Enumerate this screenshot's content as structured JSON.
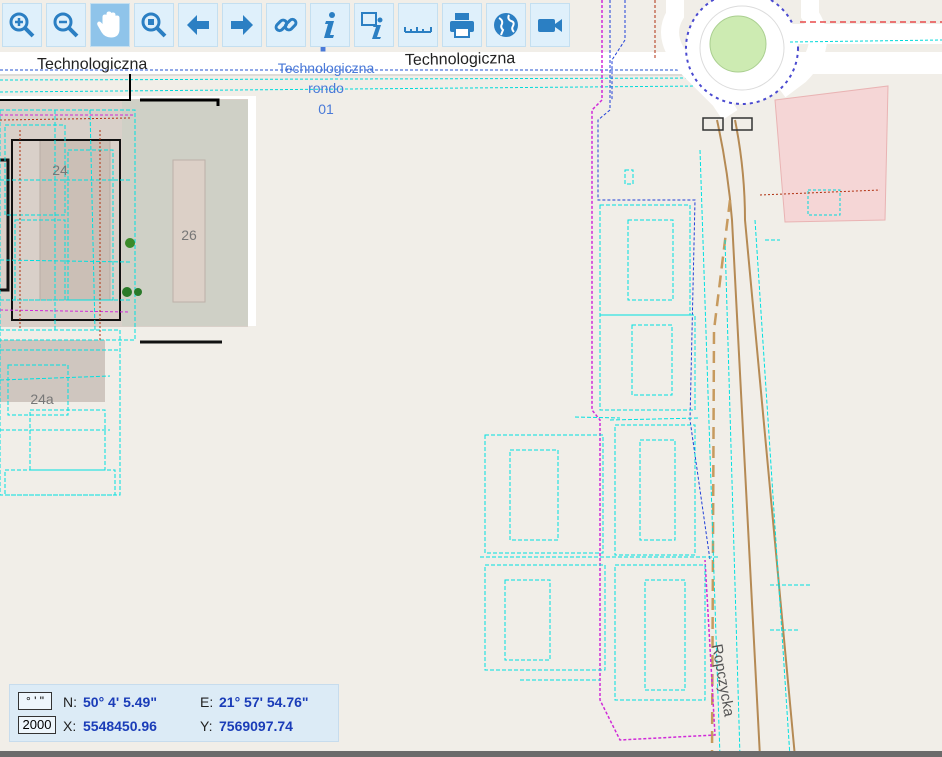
{
  "toolbar": {
    "buttons": [
      {
        "name": "zoom-in",
        "icon": "zoom-in-icon"
      },
      {
        "name": "zoom-out",
        "icon": "zoom-out-icon"
      },
      {
        "name": "pan",
        "icon": "hand-icon",
        "active": true
      },
      {
        "name": "zoom-extent",
        "icon": "zoom-extent-icon"
      },
      {
        "name": "back",
        "icon": "arrow-left-icon"
      },
      {
        "name": "forward",
        "icon": "arrow-right-icon"
      },
      {
        "name": "link",
        "icon": "link-icon"
      },
      {
        "name": "info",
        "icon": "info-icon"
      },
      {
        "name": "info-area",
        "icon": "info-area-icon"
      },
      {
        "name": "measure",
        "icon": "ruler-icon"
      },
      {
        "name": "print",
        "icon": "printer-icon"
      },
      {
        "name": "globe",
        "icon": "globe-icon"
      },
      {
        "name": "camera",
        "icon": "video-camera-icon"
      }
    ]
  },
  "map": {
    "street_top_left": "Technologiczna",
    "street_top_right": "Technologiczna",
    "bus_stop_line1": "Technologiczna",
    "bus_stop_line2": "rondo",
    "bus_stop_line3": "01",
    "street_vertical": "Ropczycka",
    "building_24": "24",
    "building_26": "26",
    "building_24a": "24a"
  },
  "coords": {
    "format_button": "° ' \"",
    "scale_value": "2000",
    "n_label": "N:",
    "n_value": "50° 4' 5.49\"",
    "e_label": "E:",
    "e_value": "21° 57' 54.76\"",
    "x_label": "X:",
    "x_value": "5548450.96",
    "y_label": "Y:",
    "y_value": "7569097.74"
  },
  "colors": {
    "background": "#f1eee8",
    "cyan_lines": "#00e5e5",
    "magenta_lines": "#d02ad8",
    "blue_lines": "#2040d8",
    "toolbar_bg": "#dff0fb",
    "toolbar_icon": "#2b7fc3",
    "coord_value": "#1a3cb8"
  }
}
